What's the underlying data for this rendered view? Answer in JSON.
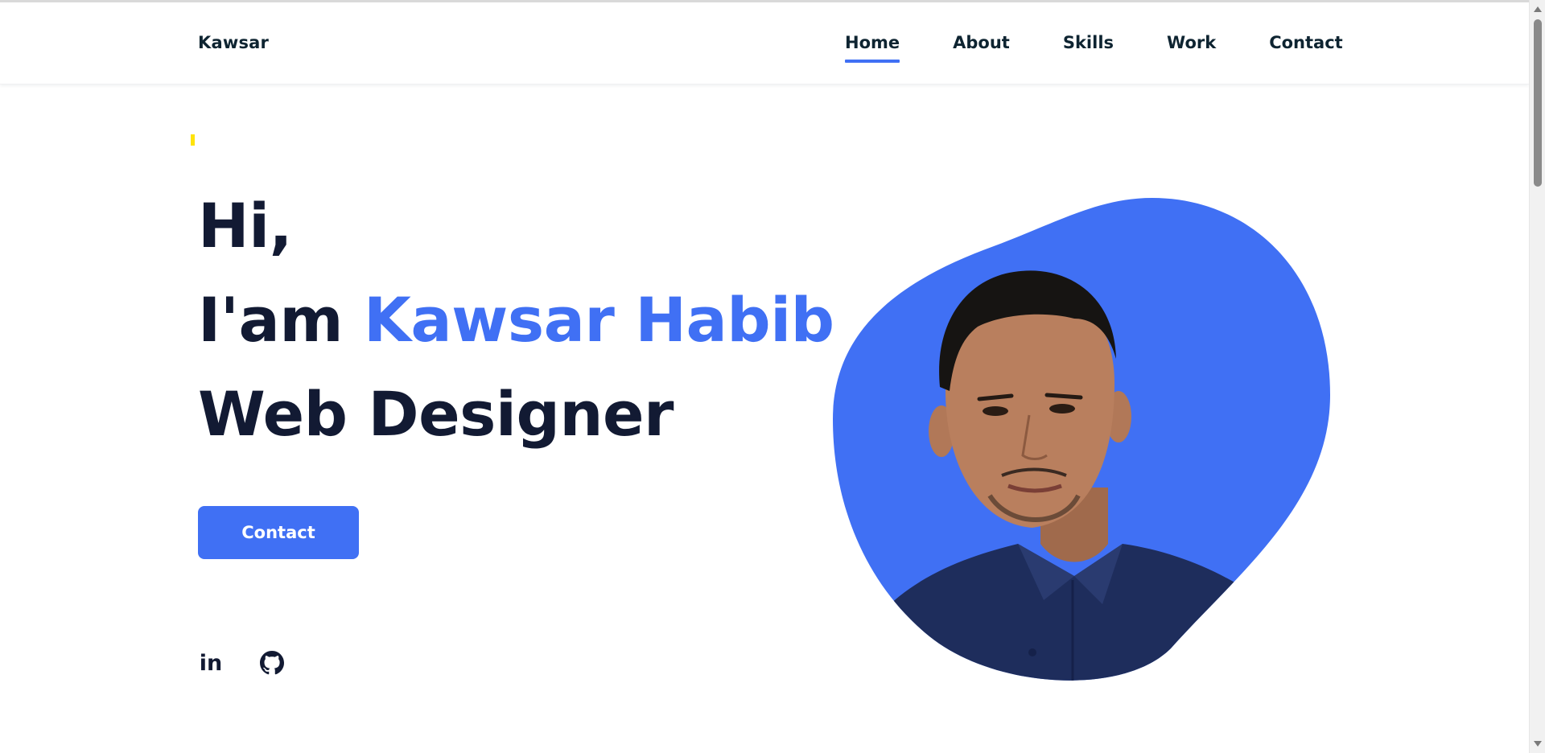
{
  "header": {
    "logo": "Kawsar",
    "nav": [
      {
        "label": "Home",
        "active": true
      },
      {
        "label": "About",
        "active": false
      },
      {
        "label": "Skills",
        "active": false
      },
      {
        "label": "Work",
        "active": false
      },
      {
        "label": "Contact",
        "active": false
      }
    ]
  },
  "hero": {
    "line1": "Hi,",
    "line2_prefix": "I'am ",
    "line2_name": "Kawsar Habib",
    "line3": "Web Designer",
    "contact_button": "Contact",
    "social": [
      {
        "icon": "linkedin-icon",
        "glyph": "in"
      },
      {
        "icon": "github-icon"
      }
    ]
  },
  "colors": {
    "accent": "#4070f4",
    "heading": "#121a33",
    "text": "#0e2431",
    "marker": "#ffe30b"
  }
}
